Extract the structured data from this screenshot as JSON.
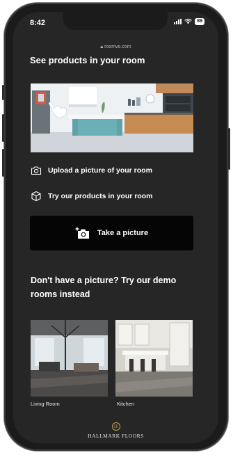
{
  "status_bar": {
    "time": "8:42",
    "battery": "89"
  },
  "browser": {
    "url": "roomvo.com"
  },
  "page": {
    "title": "See products in your room"
  },
  "steps": [
    {
      "icon": "camera-outline-icon",
      "label": "Upload a picture of your room"
    },
    {
      "icon": "cube-outline-icon",
      "label": "Try our products in your room"
    }
  ],
  "cta": {
    "label": "Take a picture",
    "icon": "camera-plus-icon"
  },
  "demo": {
    "heading": "Don't have a picture? Try our demo rooms instead",
    "rooms": [
      {
        "label": "Living Room"
      },
      {
        "label": "Kitchen"
      }
    ]
  },
  "brand": {
    "mark": "H",
    "name": "HALLMARK FLOORS"
  },
  "colors": {
    "background": "#262626",
    "cta": "#050505",
    "brand_gold": "#c9a44e"
  }
}
